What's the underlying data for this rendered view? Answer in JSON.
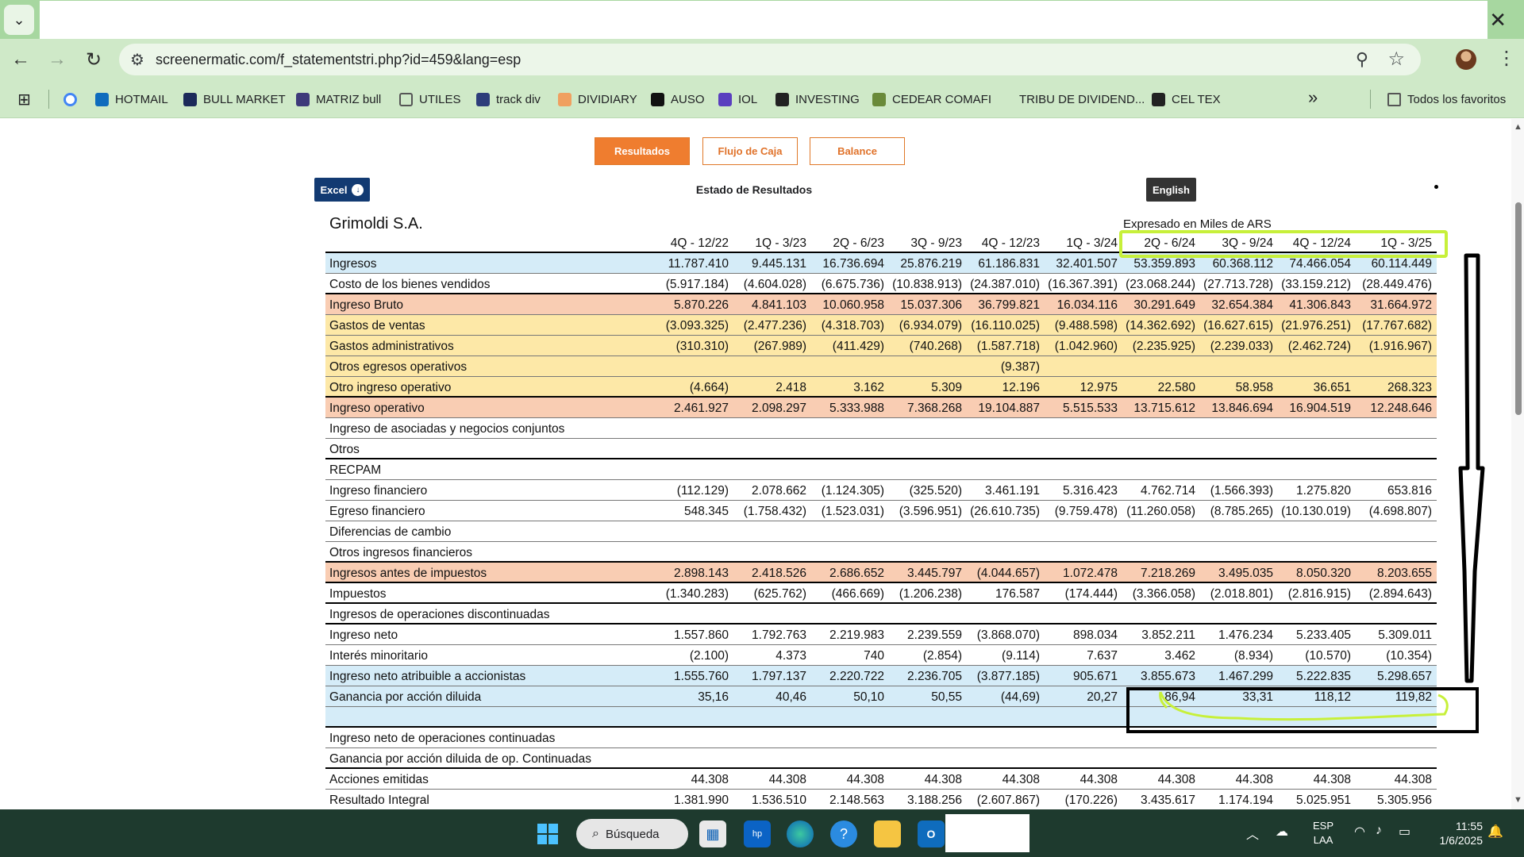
{
  "browser": {
    "url": "screenermatic.com/f_statementstri.php?id=459&lang=esp",
    "bookmarks": [
      {
        "label": "",
        "icon": "google-icon",
        "color": "#ffffff"
      },
      {
        "label": "HOTMAIL",
        "icon": "outlook-icon",
        "color": "#0f6cbd"
      },
      {
        "label": "BULL MARKET",
        "icon": "bull-market-icon",
        "color": "#1c2a5a"
      },
      {
        "label": "MATRIZ bull",
        "icon": "matriz-icon",
        "color": "#3e3a7a"
      },
      {
        "label": "UTILES",
        "icon": "folder-icon",
        "color": "#cfe9c8"
      },
      {
        "label": "track div",
        "icon": "track-div-icon",
        "color": "#2d3d7a"
      },
      {
        "label": "DIVIDIARY",
        "icon": "dividiary-icon",
        "color": "#f0a060"
      },
      {
        "label": "AUSO",
        "icon": "auso-icon",
        "color": "#111111"
      },
      {
        "label": "IOL",
        "icon": "iol-icon",
        "color": "#5a3fbf"
      },
      {
        "label": "INVESTING",
        "icon": "investing-icon",
        "color": "#222222"
      },
      {
        "label": "CEDEAR COMAFI",
        "icon": "comafi-icon",
        "color": "#6a8a3a"
      },
      {
        "label": "TRIBU DE DIVIDEND...",
        "icon": "tribu-icon",
        "color": "#cfe9c8"
      },
      {
        "label": "CEL TEX",
        "icon": "celtex-icon",
        "color": "#222222"
      }
    ],
    "more_label": "»",
    "all_favorites": "Todos los favoritos"
  },
  "page": {
    "tabs": [
      "Resultados",
      "Flujo de Caja",
      "Balance"
    ],
    "excel_label": "Excel",
    "title": "Estado de Resultados",
    "english_label": "English",
    "company": "Grimoldi S.A.",
    "units": "Expresado en Miles de ARS"
  },
  "table": {
    "periods": [
      "4Q - 12/22",
      "1Q - 3/23",
      "2Q - 6/23",
      "3Q - 9/23",
      "4Q - 12/23",
      "1Q - 3/24",
      "2Q - 6/24",
      "3Q - 9/24",
      "4Q - 12/24",
      "1Q - 3/25"
    ],
    "rows": [
      {
        "label": "Ingresos",
        "style": "blue",
        "values": [
          "11.787.410",
          "9.445.131",
          "16.736.694",
          "25.876.219",
          "61.186.831",
          "32.401.507",
          "53.359.893",
          "60.368.112",
          "74.466.054",
          "60.114.449"
        ]
      },
      {
        "label": "Costo de los bienes vendidos",
        "style": "thick",
        "values": [
          "(5.917.184)",
          "(4.604.028)",
          "(6.675.736)",
          "(10.838.913)",
          "(24.387.010)",
          "(16.367.391)",
          "(23.068.244)",
          "(27.713.728)",
          "(33.159.212)",
          "(28.449.476)"
        ]
      },
      {
        "label": "Ingreso Bruto",
        "style": "salmon",
        "values": [
          "5.870.226",
          "4.841.103",
          "10.060.958",
          "15.037.306",
          "36.799.821",
          "16.034.116",
          "30.291.649",
          "32.654.384",
          "41.306.843",
          "31.664.972"
        ]
      },
      {
        "label": "Gastos de ventas",
        "style": "yellow",
        "values": [
          "(3.093.325)",
          "(2.477.236)",
          "(4.318.703)",
          "(6.934.079)",
          "(16.110.025)",
          "(9.488.598)",
          "(14.362.692)",
          "(16.627.615)",
          "(21.976.251)",
          "(17.767.682)"
        ]
      },
      {
        "label": "Gastos administrativos",
        "style": "yellow",
        "values": [
          "(310.310)",
          "(267.989)",
          "(411.429)",
          "(740.268)",
          "(1.587.718)",
          "(1.042.960)",
          "(2.235.925)",
          "(2.239.033)",
          "(2.462.724)",
          "(1.916.967)"
        ]
      },
      {
        "label": "Otros egresos operativos",
        "style": "yellow",
        "values": [
          "",
          "",
          "",
          "",
          "(9.387)",
          "",
          "",
          "",
          "",
          ""
        ]
      },
      {
        "label": "Otro ingreso operativo",
        "style": "yellow thick",
        "values": [
          "(4.664)",
          "2.418",
          "3.162",
          "5.309",
          "12.196",
          "12.975",
          "22.580",
          "58.958",
          "36.651",
          "268.323"
        ]
      },
      {
        "label": "Ingreso operativo",
        "style": "salmon",
        "values": [
          "2.461.927",
          "2.098.297",
          "5.333.988",
          "7.368.268",
          "19.104.887",
          "5.515.533",
          "13.715.612",
          "13.846.694",
          "16.904.519",
          "12.248.646"
        ]
      },
      {
        "label": "Ingreso de asociadas y negocios conjuntos",
        "style": "",
        "values": [
          "",
          "",
          "",
          "",
          "",
          "",
          "",
          "",
          "",
          ""
        ]
      },
      {
        "label": "Otros",
        "style": "thick",
        "values": [
          "",
          "",
          "",
          "",
          "",
          "",
          "",
          "",
          "",
          ""
        ]
      },
      {
        "label": "RECPAM",
        "style": "",
        "values": [
          "",
          "",
          "",
          "",
          "",
          "",
          "",
          "",
          "",
          ""
        ]
      },
      {
        "label": "Ingreso financiero",
        "style": "",
        "values": [
          "(112.129)",
          "2.078.662",
          "(1.124.305)",
          "(325.520)",
          "3.461.191",
          "5.316.423",
          "4.762.714",
          "(1.566.393)",
          "1.275.820",
          "653.816"
        ]
      },
      {
        "label": "Egreso financiero",
        "style": "",
        "values": [
          "548.345",
          "(1.758.432)",
          "(1.523.031)",
          "(3.596.951)",
          "(26.610.735)",
          "(9.759.478)",
          "(11.260.058)",
          "(8.785.265)",
          "(10.130.019)",
          "(4.698.807)"
        ]
      },
      {
        "label": "Diferencias de cambio",
        "style": "",
        "values": [
          "",
          "",
          "",
          "",
          "",
          "",
          "",
          "",
          "",
          ""
        ]
      },
      {
        "label": "Otros ingresos financieros",
        "style": "thick",
        "values": [
          "",
          "",
          "",
          "",
          "",
          "",
          "",
          "",
          "",
          ""
        ]
      },
      {
        "label": "Ingresos antes de impuestos",
        "style": "salmon thick",
        "values": [
          "2.898.143",
          "2.418.526",
          "2.686.652",
          "3.445.797",
          "(4.044.657)",
          "1.072.478",
          "7.218.269",
          "3.495.035",
          "8.050.320",
          "8.203.655"
        ]
      },
      {
        "label": "Impuestos",
        "style": "thick",
        "values": [
          "(1.340.283)",
          "(625.762)",
          "(466.669)",
          "(1.206.238)",
          "176.587",
          "(174.444)",
          "(3.366.058)",
          "(2.018.801)",
          "(2.816.915)",
          "(2.894.643)"
        ]
      },
      {
        "label": "Ingresos de operaciones discontinuadas",
        "style": "thick",
        "values": [
          "",
          "",
          "",
          "",
          "",
          "",
          "",
          "",
          "",
          ""
        ]
      },
      {
        "label": "Ingreso neto",
        "style": "",
        "values": [
          "1.557.860",
          "1.792.763",
          "2.219.983",
          "2.239.559",
          "(3.868.070)",
          "898.034",
          "3.852.211",
          "1.476.234",
          "5.233.405",
          "5.309.011"
        ]
      },
      {
        "label": "Interés minoritario",
        "style": "",
        "values": [
          "(2.100)",
          "4.373",
          "740",
          "(2.854)",
          "(9.114)",
          "7.637",
          "3.462",
          "(8.934)",
          "(10.570)",
          "(10.354)"
        ]
      },
      {
        "label": "Ingreso neto atribuible a accionistas",
        "style": "blue",
        "values": [
          "1.555.760",
          "1.797.137",
          "2.220.722",
          "2.236.705",
          "(3.877.185)",
          "905.671",
          "3.855.673",
          "1.467.299",
          "5.222.835",
          "5.298.657"
        ]
      },
      {
        "label": "Ganancia por acción diluida",
        "style": "blue",
        "values": [
          "35,16",
          "40,46",
          "50,10",
          "50,55",
          "(44,69)",
          "20,27",
          "86,94",
          "33,31",
          "118,12",
          "119,82"
        ]
      },
      {
        "label": "",
        "style": "blue thick",
        "values": [
          "",
          "",
          "",
          "",
          "",
          "",
          "",
          "",
          "",
          ""
        ]
      },
      {
        "label": "Ingreso neto de operaciones continuadas",
        "style": "",
        "values": [
          "",
          "",
          "",
          "",
          "",
          "",
          "",
          "",
          "",
          ""
        ]
      },
      {
        "label": "Ganancia por acción diluida de op. Continuadas",
        "style": "thick",
        "values": [
          "",
          "",
          "",
          "",
          "",
          "",
          "",
          "",
          "",
          ""
        ]
      },
      {
        "label": "Acciones emitidas",
        "style": "",
        "values": [
          "44.308",
          "44.308",
          "44.308",
          "44.308",
          "44.308",
          "44.308",
          "44.308",
          "44.308",
          "44.308",
          "44.308"
        ]
      },
      {
        "label": "Resultado Integral",
        "style": "",
        "values": [
          "1.381.990",
          "1.536.510",
          "2.148.563",
          "3.188.256",
          "(2.607.867)",
          "(170.226)",
          "3.435.617",
          "1.174.194",
          "5.025.951",
          "5.305.956"
        ]
      }
    ]
  },
  "taskbar": {
    "search_label": "Búsqueda",
    "lang_top": "ESP",
    "lang_bottom": "LAA",
    "time": "11:55",
    "date": "1/6/2025"
  },
  "colors": {
    "tab_active": "#ef7d2f",
    "row_blue": "#d5ecf8",
    "row_salmon": "#f9cdb3",
    "row_yellow": "#fde8a7",
    "annotation_highlight": "#c7f03a"
  }
}
